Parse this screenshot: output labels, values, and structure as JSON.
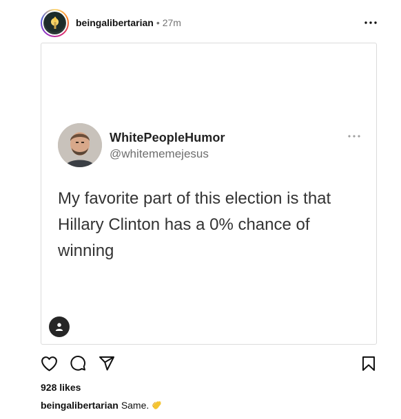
{
  "post": {
    "username": "beingalibertarian",
    "separator": "•",
    "time": "27m",
    "likes": "928 likes",
    "caption_user": "beingalibertarian",
    "caption_text": "Same.",
    "caption_emoji": "clapping-hands-icon"
  },
  "tweet": {
    "display_name": "WhitePeopleHumor",
    "handle": "@whitememejesus",
    "text": "My favorite part of this election is that Hillary Clinton has a 0% chance of winning"
  },
  "icons": {
    "more": "more-horizontal-icon",
    "like": "heart-icon",
    "comment": "comment-icon",
    "share": "send-icon",
    "save": "bookmark-icon",
    "tag": "user-tag-icon"
  },
  "colors": {
    "text_primary": "#111111",
    "text_secondary": "#737373",
    "border": "#dbdbdb",
    "tweet_text": "#333333",
    "tweet_handle": "#6e6e6e"
  }
}
